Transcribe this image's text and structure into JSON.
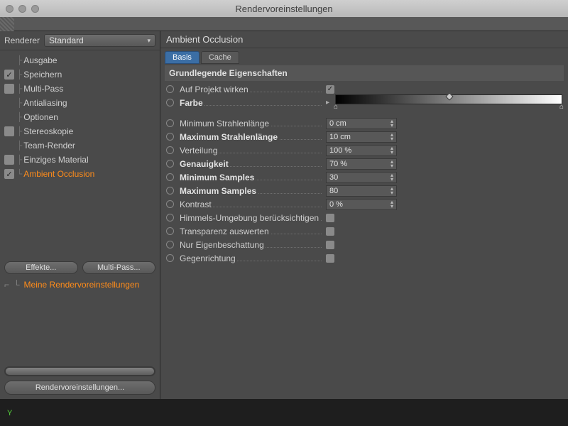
{
  "window": {
    "title": "Rendervoreinstellungen"
  },
  "sidebar": {
    "renderer_label": "Renderer",
    "renderer_value": "Standard",
    "items": [
      {
        "label": "Ausgabe",
        "checkbox": false,
        "checked": false,
        "selected": false
      },
      {
        "label": "Speichern",
        "checkbox": true,
        "checked": true,
        "selected": false
      },
      {
        "label": "Multi-Pass",
        "checkbox": true,
        "checked": false,
        "selected": false
      },
      {
        "label": "Antialiasing",
        "checkbox": false,
        "checked": false,
        "selected": false
      },
      {
        "label": "Optionen",
        "checkbox": false,
        "checked": false,
        "selected": false
      },
      {
        "label": "Stereoskopie",
        "checkbox": true,
        "checked": false,
        "selected": false
      },
      {
        "label": "Team-Render",
        "checkbox": false,
        "checked": false,
        "selected": false
      },
      {
        "label": "Einziges Material",
        "checkbox": true,
        "checked": false,
        "selected": false
      },
      {
        "label": "Ambient Occlusion",
        "checkbox": true,
        "checked": true,
        "selected": true
      }
    ],
    "effects_btn": "Effekte...",
    "multipass_btn": "Multi-Pass...",
    "preset_label": "Meine Rendervoreinstellungen",
    "big_btn": "Rendervoreinstellungen..."
  },
  "panel": {
    "title": "Ambient Occlusion",
    "tabs": {
      "basis": "Basis",
      "cache": "Cache"
    },
    "section": "Grundlegende Eigenschaften",
    "props": {
      "apply": "Auf Projekt wirken",
      "color": "Farbe",
      "minray": {
        "label": "Minimum Strahlenlänge",
        "value": "0 cm"
      },
      "maxray": {
        "label": "Maximum Strahlenlänge",
        "value": "10 cm"
      },
      "spread": {
        "label": "Verteilung",
        "value": "100 %"
      },
      "accuracy": {
        "label": "Genauigkeit",
        "value": "70 %"
      },
      "minsamp": {
        "label": "Minimum Samples",
        "value": "30"
      },
      "maxsamp": {
        "label": "Maximum Samples",
        "value": "80"
      },
      "contrast": {
        "label": "Kontrast",
        "value": "0 %"
      },
      "sky": "Himmels-Umgebung berücksichtigen",
      "trans": "Transparenz auswerten",
      "selfshadow": "Nur Eigenbeschattung",
      "reverse": "Gegenrichtung"
    }
  },
  "footer": {
    "axis": "Y"
  }
}
